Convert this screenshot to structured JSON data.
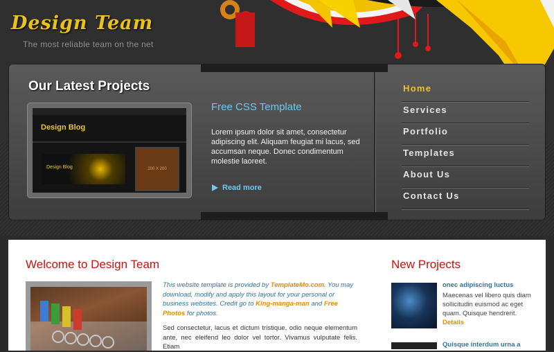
{
  "header": {
    "logo_title": "Design Team",
    "tagline": "The most reliable team on the net"
  },
  "featured": {
    "heading": "Our Latest Projects",
    "thumbnail_logo": "Design Blog",
    "thumbnail_slide_text": "Design Blog",
    "thumbnail_box_text": "200 X 200",
    "title": "Free CSS Template",
    "text": "Lorem ipsum dolor sit amet, consectetur adipiscing elit. Aliquam feugiat mi lacus, sed accumsan neque. Donec condimentum molestie laoreet.",
    "read_more": "Read more",
    "read_more_icon": "play-arrow-icon"
  },
  "menu": {
    "items": [
      {
        "label": "Home",
        "active": true
      },
      {
        "label": "Services",
        "active": false
      },
      {
        "label": "Portfolio",
        "active": false
      },
      {
        "label": "Templates",
        "active": false
      },
      {
        "label": "About Us",
        "active": false
      },
      {
        "label": "Contact Us",
        "active": false
      }
    ]
  },
  "welcome": {
    "heading": "Welcome to Design Team",
    "intro_1": "This website template is provided by ",
    "intro_link_1": "TemplateMo.com",
    "intro_2": ". You may download, modify and apply this layout for your personal or business websites. Credit go to ",
    "intro_link_2": "King-manga-man",
    "intro_3": " and ",
    "intro_link_3": "Free Photos",
    "intro_4": " for photos.",
    "body": "Sed consectetur, lacus et dictum tristique, odio neque elementum ante, nec eleifend leo dolor vel tortor. Vivamus vulputate felis. Etiam"
  },
  "new_projects": {
    "heading": "New Projects",
    "items": [
      {
        "title": "onec adipiscing luctus",
        "text": "Maecenas vel libero quis diam sollicitudin euismod ac eget quam. Quisque hendrerit.",
        "link": "Details"
      },
      {
        "title": "Quisque interdum urna a"
      }
    ]
  },
  "colors": {
    "accent_yellow": "#e9c21a",
    "link_blue": "#6fc8f0",
    "heading_red": "#c8130f",
    "credit_orange": "#e88a00"
  }
}
